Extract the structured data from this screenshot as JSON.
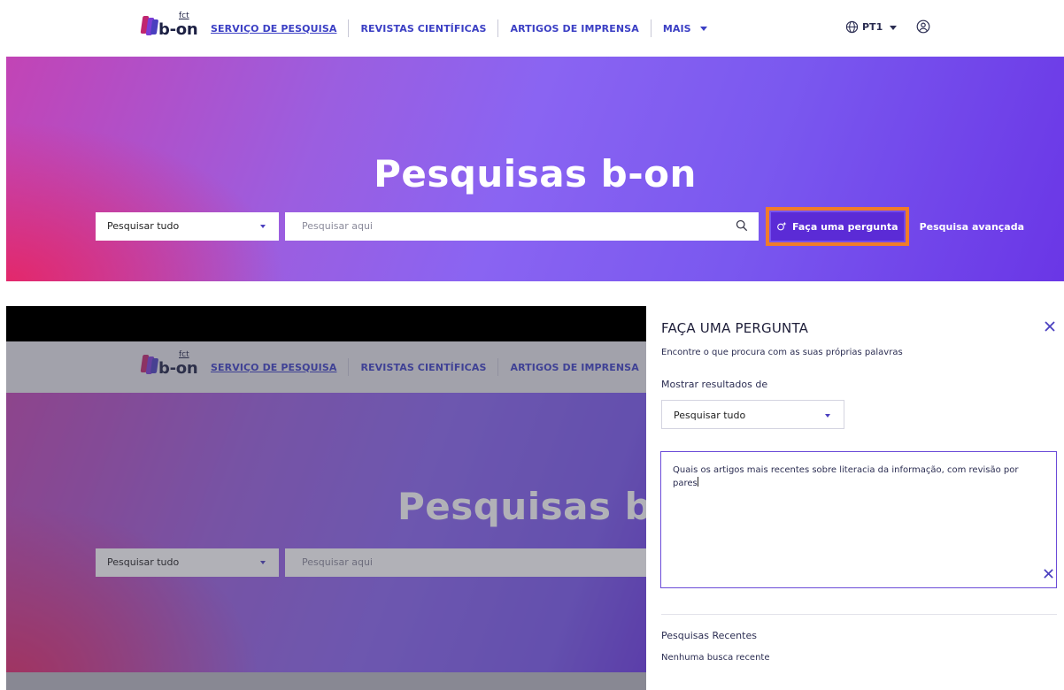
{
  "brand": {
    "logo_text": "b-on",
    "logo_sup": "fct"
  },
  "nav": {
    "items": [
      "SERVIÇO DE PESQUISA",
      "REVISTAS CIENTÍFICAS",
      "ARTIGOS DE IMPRENSA",
      "MAIS"
    ]
  },
  "tools": {
    "language": "PT1"
  },
  "hero": {
    "title": "Pesquisas b-on",
    "title_cropped": "Pesquisas b-",
    "scope_value": "Pesquisar tudo",
    "search_placeholder": "Pesquisar aqui",
    "ask_label": "Faça uma pergunta",
    "advanced_label": "Pesquisa avançada"
  },
  "drawer": {
    "title": "FAÇA UMA PERGUNTA",
    "subtitle": "Encontre o que procura com as suas próprias palavras",
    "results_label": "Mostrar resultados de",
    "results_value": "Pesquisar tudo",
    "question_text": "Quais os artigos mais recentes sobre literacia da informação, com revisão por pares",
    "recent_title": "Pesquisas Recentes",
    "recent_empty": "Nenhuma busca recente"
  },
  "colors": {
    "accent": "#3b3fc4",
    "button": "#5b2bd6",
    "highlight": "#f07c2a",
    "hero_pink": "#e3286b",
    "hero_purple": "#7a58ef"
  }
}
